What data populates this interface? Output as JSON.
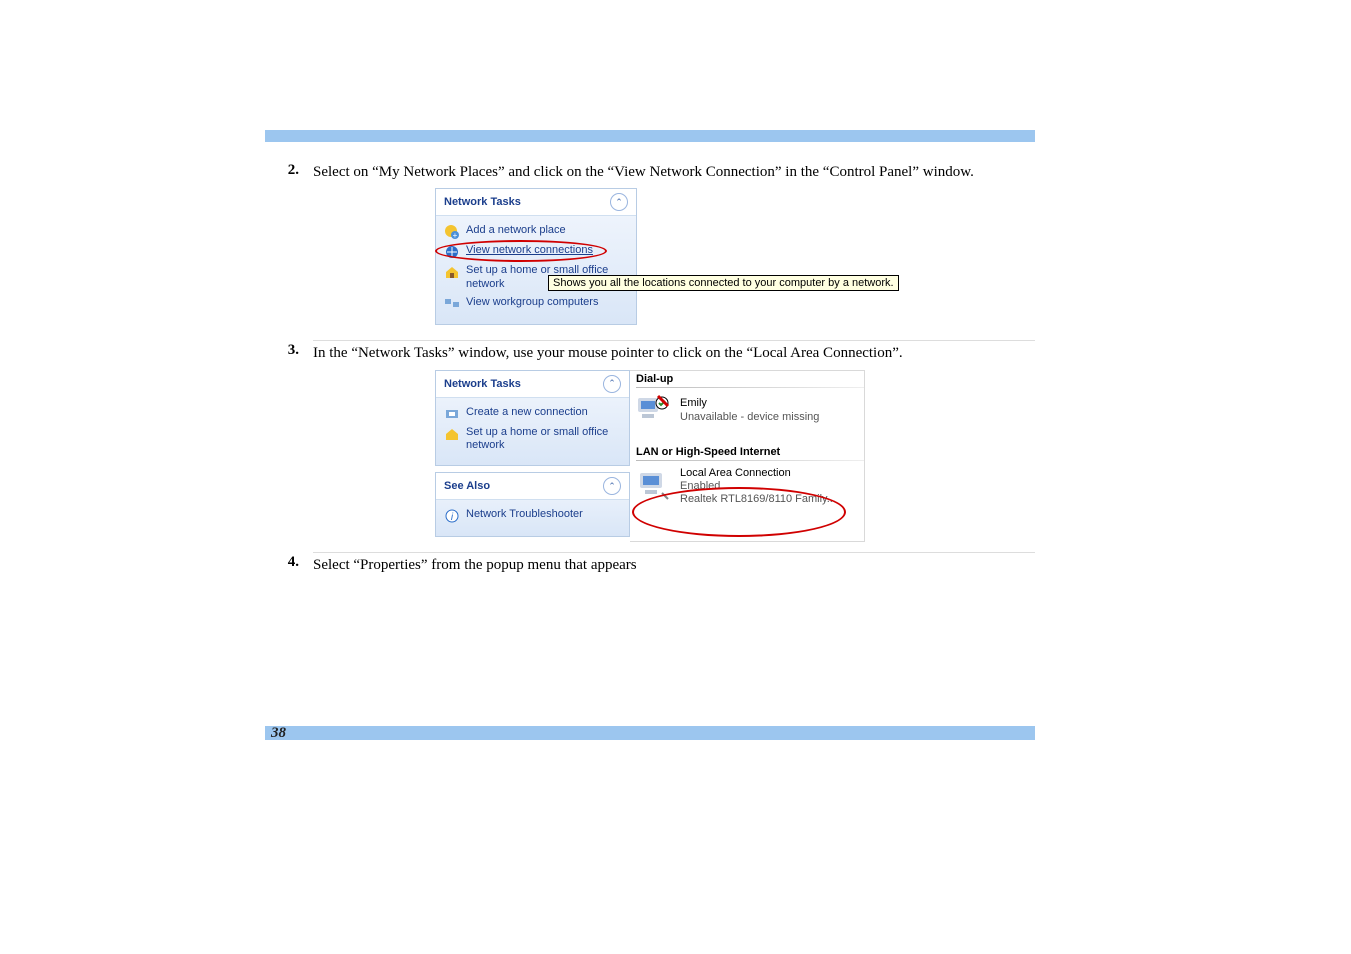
{
  "page_number": "38",
  "steps": {
    "s2": {
      "num": "2.",
      "text": "Select on “My Network Places” and click on the “View Network Connection” in the “Control Panel” window."
    },
    "s3": {
      "num": "3.",
      "text": "In the “Network Tasks” window, use your mouse pointer to click on the “Local Area Connection”."
    },
    "s4": {
      "num": "4.",
      "text": "Select “Properties” from the popup menu that appears"
    }
  },
  "fig1": {
    "header": "Network Tasks",
    "items": {
      "add": "Add a network place",
      "view": "View network connections",
      "setup": "Set up a home or small office network",
      "workgroup": "View workgroup computers"
    },
    "tooltip": "Shows you all the locations connected to your computer by a network."
  },
  "fig2": {
    "panel1": {
      "header": "Network Tasks",
      "items": {
        "create": "Create a new connection",
        "setup": "Set up a home or small office network"
      }
    },
    "panel2": {
      "header": "See Also",
      "items": {
        "trouble": "Network Troubleshooter"
      }
    },
    "right": {
      "cat1": "Dial-up",
      "conn1": {
        "name": "Emily",
        "status": "Unavailable - device missing"
      },
      "cat2": "LAN or High-Speed Internet",
      "conn2": {
        "name": "Local Area Connection",
        "status": "Enabled",
        "device": "Realtek RTL8169/8110 Family..."
      }
    }
  }
}
